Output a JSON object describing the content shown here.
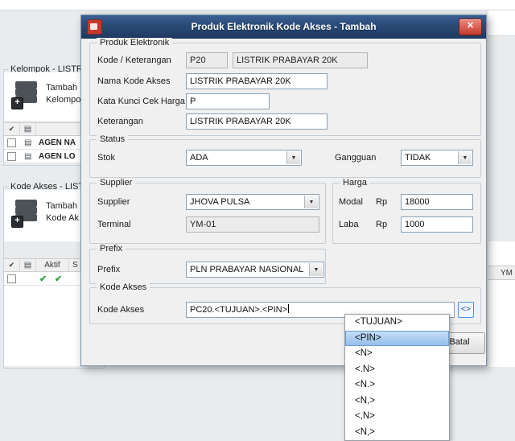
{
  "icons": {
    "close": "✕",
    "dropdown": "▼",
    "check": "✔",
    "stack": "▤",
    "plus": "+"
  },
  "background": {
    "kelompok": {
      "legend": "Kelompok - LISTRI",
      "add_line1": "Tambah",
      "add_line2": "Kelompok",
      "rows": [
        "AGEN NA",
        "AGEN LO"
      ]
    },
    "kode_akses": {
      "legend": "Kode Akses - LISTR",
      "add_line1": "Tambah",
      "add_line2": "Kode Ak",
      "col_aktif": "Aktif",
      "col_s": "S"
    },
    "right_col_header": "YM"
  },
  "dialog": {
    "title": "Produk Elektronik Kode Akses - Tambah",
    "produk": {
      "legend": "Produk Elektronik",
      "kode_label": "Kode / Keterangan",
      "kode": "P20",
      "kode_desc": "LISTRIK PRABAYAR 20K",
      "nama_label": "Nama Kode Akses",
      "nama": "LISTRIK PRABAYAR 20K",
      "kata_kunci_label": "Kata Kunci Cek Harga",
      "kata_kunci": "P",
      "keterangan_label": "Keterangan",
      "keterangan": "LISTRIK PRABAYAR 20K"
    },
    "status": {
      "legend": "Status",
      "stok_label": "Stok",
      "stok": "ADA",
      "gangguan_label": "Gangguan",
      "gangguan": "TIDAK"
    },
    "supplier": {
      "legend": "Supplier",
      "supplier_label": "Supplier",
      "supplier": "JHOVA PULSA",
      "terminal_label": "Terminal",
      "terminal": "YM-01"
    },
    "harga": {
      "legend": "Harga",
      "modal_label": "Modal",
      "modal_rp": "Rp",
      "modal": "18000",
      "laba_label": "Laba",
      "laba_rp": "Rp",
      "laba": "1000"
    },
    "prefix": {
      "legend": "Prefix",
      "prefix_label": "Prefix",
      "prefix": "PLN PRABAYAR NASIONAL"
    },
    "kode_akses": {
      "legend": "Kode Akses",
      "label": "Kode Akses",
      "value": "PC20.<TUJUAN>.<PIN>",
      "insert_button": "<>"
    },
    "batal": "Batal"
  },
  "popup": {
    "items": [
      "<TUJUAN>",
      "<PIN>",
      "<N>",
      "<.N>",
      "<N.>",
      "<N,>",
      "<,N>",
      "<N,>"
    ],
    "selected_index": 1
  }
}
